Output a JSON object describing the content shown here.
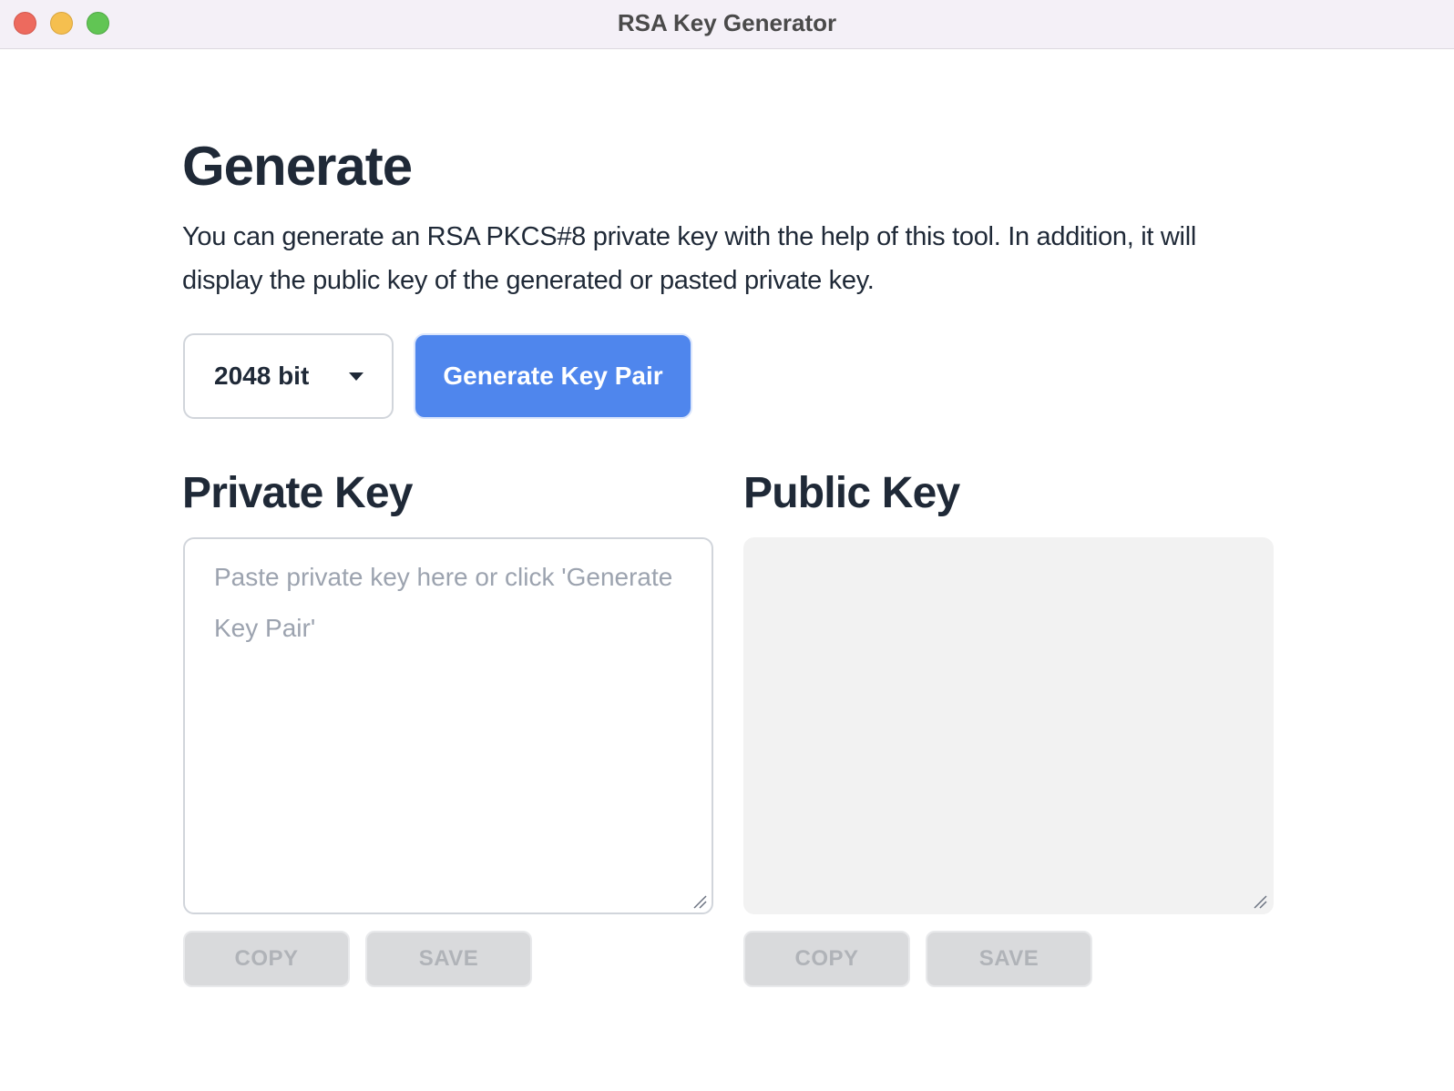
{
  "window": {
    "title": "RSA Key Generator"
  },
  "generate": {
    "title": "Generate",
    "description": "You can generate an RSA PKCS#8 private key with the help of this tool. In addition, it will display the public key of the generated or pasted private key.",
    "bit_select": {
      "value": "2048 bit",
      "icon": "chevron-down-icon"
    },
    "generate_button_label": "Generate Key Pair",
    "accent_color": "#4f86ed"
  },
  "private_key": {
    "title": "Private Key",
    "placeholder": "Paste private key here or click 'Generate Key Pair'",
    "value": "",
    "copy_label": "COPY",
    "save_label": "SAVE"
  },
  "public_key": {
    "title": "Public Key",
    "value": "",
    "copy_label": "COPY",
    "save_label": "SAVE"
  }
}
